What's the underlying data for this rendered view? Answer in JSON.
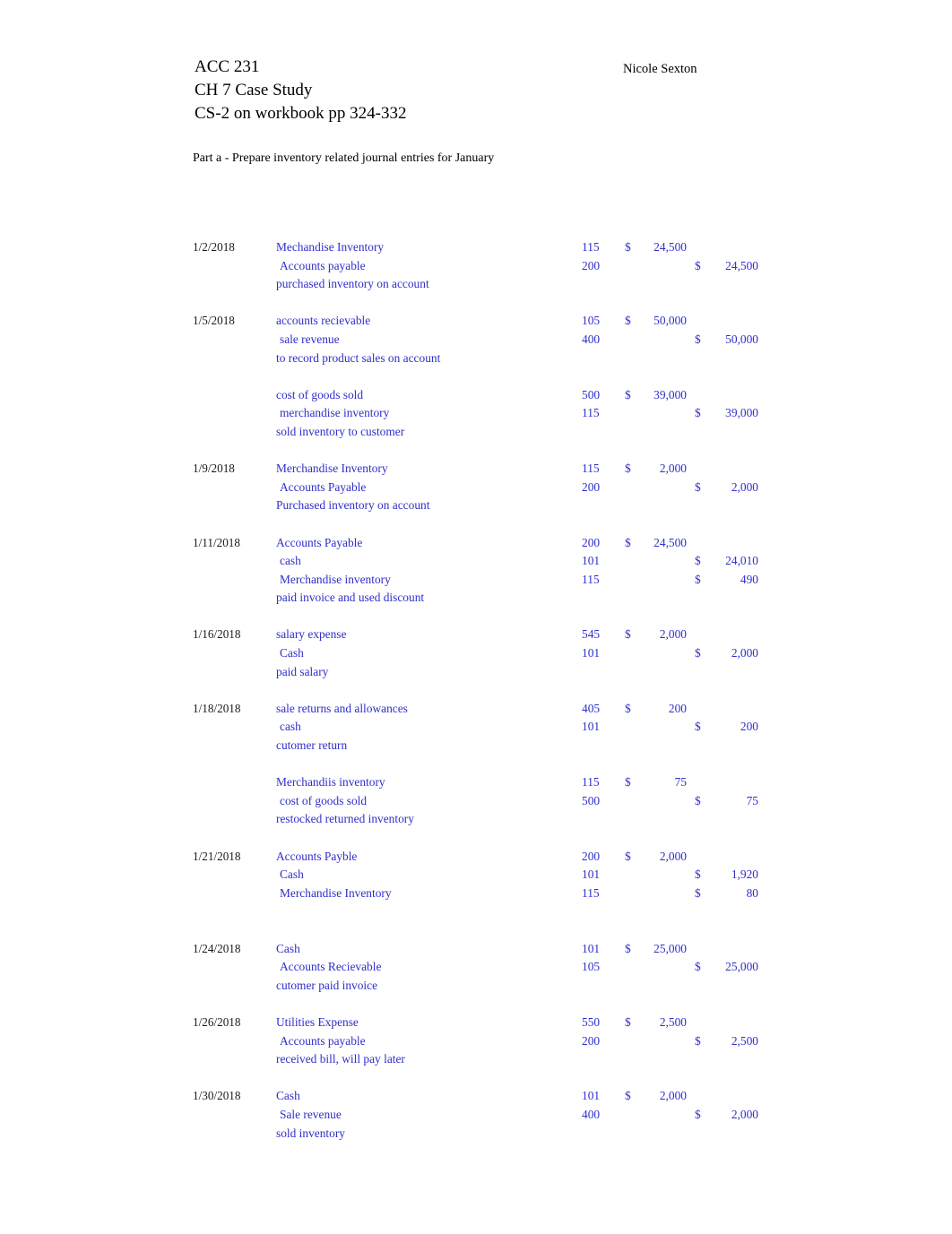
{
  "header": {
    "course": "ACC 231",
    "assignment": "CH 7 Case Study",
    "reference": "CS-2 on workbook pp 324-332",
    "author": "Nicole Sexton",
    "part_label": "Part a - Prepare inventory related journal entries for January"
  },
  "colors": {
    "entry_text": "#2F2FCB",
    "date_text": "#1a1a1a",
    "page_background": "#ffffff"
  },
  "currency_symbol": "$",
  "journal": {
    "rows": [
      {
        "date": "1/2/2018",
        "account": "Mechandise Inventory",
        "indent": false,
        "code": "115",
        "debit": "24,500",
        "credit": ""
      },
      {
        "date": "",
        "account": "Accounts payable",
        "indent": true,
        "code": "200",
        "debit": "",
        "credit": "24,500"
      },
      {
        "date": "",
        "account": "purchased inventory on account",
        "memo": true,
        "code": "",
        "debit": "",
        "credit": ""
      },
      {
        "spacer": true
      },
      {
        "date": "1/5/2018",
        "account": "accounts recievable",
        "indent": false,
        "code": "105",
        "debit": "50,000",
        "credit": ""
      },
      {
        "date": "",
        "account": "sale revenue",
        "indent": true,
        "code": "400",
        "debit": "",
        "credit": "50,000"
      },
      {
        "date": "",
        "account": "to record product sales on account",
        "memo": true,
        "code": "",
        "debit": "",
        "credit": ""
      },
      {
        "spacer": true
      },
      {
        "date": "",
        "account": "cost of goods sold",
        "indent": false,
        "code": "500",
        "debit": "39,000",
        "credit": ""
      },
      {
        "date": "",
        "account": "merchandise inventory",
        "indent": true,
        "code": "115",
        "debit": "",
        "credit": "39,000"
      },
      {
        "date": "",
        "account": "sold inventory to customer",
        "memo": true,
        "code": "",
        "debit": "",
        "credit": ""
      },
      {
        "spacer": true
      },
      {
        "date": "1/9/2018",
        "account": "Merchandise Inventory",
        "indent": false,
        "code": "115",
        "debit": "2,000",
        "credit": ""
      },
      {
        "date": "",
        "account": "Accounts Payable",
        "indent": true,
        "code": "200",
        "debit": "",
        "credit": "2,000"
      },
      {
        "date": "",
        "account": "Purchased inventory on account",
        "memo": true,
        "code": "",
        "debit": "",
        "credit": ""
      },
      {
        "spacer": true
      },
      {
        "date": "1/11/2018",
        "account": "Accounts Payable",
        "indent": false,
        "code": "200",
        "debit": "24,500",
        "credit": ""
      },
      {
        "date": "",
        "account": "cash",
        "indent": true,
        "code": "101",
        "debit": "",
        "credit": "24,010"
      },
      {
        "date": "",
        "account": "Merchandise inventory",
        "indent": true,
        "code": "115",
        "debit": "",
        "credit": "490"
      },
      {
        "date": "",
        "account": "paid invoice and used discount",
        "memo": true,
        "code": "",
        "debit": "",
        "credit": ""
      },
      {
        "spacer": true
      },
      {
        "date": "1/16/2018",
        "account": "salary expense",
        "indent": false,
        "code": "545",
        "debit": "2,000",
        "credit": ""
      },
      {
        "date": "",
        "account": "Cash",
        "indent": true,
        "code": "101",
        "debit": "",
        "credit": "2,000"
      },
      {
        "date": "",
        "account": "paid salary",
        "memo": true,
        "code": "",
        "debit": "",
        "credit": ""
      },
      {
        "spacer": true
      },
      {
        "date": "1/18/2018",
        "account": "sale returns and allowances",
        "indent": false,
        "code": "405",
        "debit": "200",
        "credit": ""
      },
      {
        "date": "",
        "account": "cash",
        "indent": true,
        "code": "101",
        "debit": "",
        "credit": "200"
      },
      {
        "date": "",
        "account": "cutomer return",
        "memo": true,
        "code": "",
        "debit": "",
        "credit": ""
      },
      {
        "spacer": true
      },
      {
        "date": "",
        "account": "Merchandiis inventory",
        "indent": false,
        "code": "115",
        "debit": "75",
        "credit": ""
      },
      {
        "date": "",
        "account": "cost of goods sold",
        "indent": true,
        "code": "500",
        "debit": "",
        "credit": "75"
      },
      {
        "date": "",
        "account": "restocked returned inventory",
        "memo": true,
        "code": "",
        "debit": "",
        "credit": ""
      },
      {
        "spacer": true
      },
      {
        "date": "1/21/2018",
        "account": "Accounts Payble",
        "indent": false,
        "code": "200",
        "debit": "2,000",
        "credit": ""
      },
      {
        "date": "",
        "account": "Cash",
        "indent": true,
        "code": "101",
        "debit": "",
        "credit": "1,920"
      },
      {
        "date": "",
        "account": "Merchandise Inventory",
        "indent": true,
        "code": "115",
        "debit": "",
        "credit": "80"
      },
      {
        "spacer": true
      },
      {
        "spacer": true
      },
      {
        "date": "1/24/2018",
        "account": "Cash",
        "indent": false,
        "code": "101",
        "debit": "25,000",
        "credit": ""
      },
      {
        "date": "",
        "account": "Accounts Recievable",
        "indent": true,
        "code": "105",
        "debit": "",
        "credit": "25,000"
      },
      {
        "date": "",
        "account": "cutomer paid invoice",
        "memo": true,
        "code": "",
        "debit": "",
        "credit": ""
      },
      {
        "spacer": true
      },
      {
        "date": "1/26/2018",
        "account": "Utilities Expense",
        "indent": false,
        "code": "550",
        "debit": "2,500",
        "credit": ""
      },
      {
        "date": "",
        "account": "Accounts payable",
        "indent": true,
        "code": "200",
        "debit": "",
        "credit": "2,500"
      },
      {
        "date": "",
        "account": "received bill, will pay later",
        "memo": true,
        "code": "",
        "debit": "",
        "credit": ""
      },
      {
        "spacer": true
      },
      {
        "date": "1/30/2018",
        "account": "Cash",
        "indent": false,
        "code": "101",
        "debit": "2,000",
        "credit": ""
      },
      {
        "date": "",
        "account": "Sale revenue",
        "indent": true,
        "code": "400",
        "debit": "",
        "credit": "2,000"
      },
      {
        "date": "",
        "account": "sold inventory",
        "memo": true,
        "code": "",
        "debit": "",
        "credit": ""
      }
    ]
  }
}
